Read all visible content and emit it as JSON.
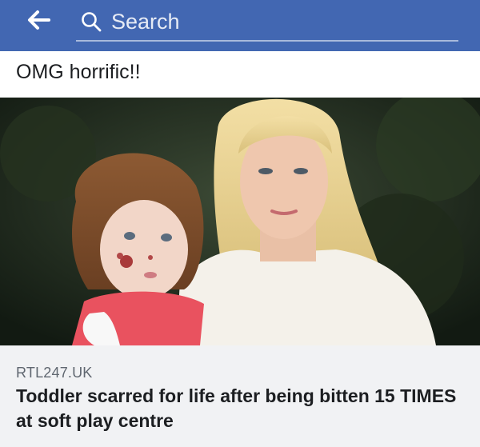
{
  "header": {
    "back_icon": "arrow-left-icon",
    "search_icon": "search-icon",
    "search_placeholder": "Search",
    "background_color": "#4267b2"
  },
  "post": {
    "text": "OMG horrific!!",
    "image_description_icon": "photo"
  },
  "link_preview": {
    "domain": "RTL247.UK",
    "title": "Toddler scarred for life after being bitten 15 TIMES at soft play centre"
  }
}
